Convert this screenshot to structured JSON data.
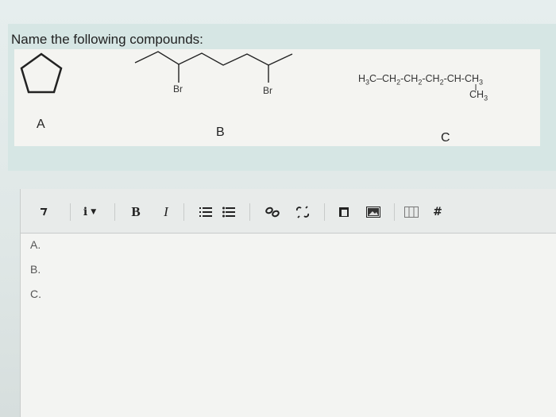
{
  "question": {
    "text": "Name the following compounds:"
  },
  "structures": {
    "labels": [
      "A",
      "B",
      "C"
    ],
    "b_substituents": [
      "Br",
      "Br"
    ],
    "c_formula": {
      "main_prefix": "H",
      "main_sub1": "3",
      "main_mid1": "C–CH",
      "main_sub2": "2",
      "main_mid2": "-CH",
      "main_sub3": "2",
      "main_mid3": "-CH",
      "main_sub4": "2",
      "main_mid4": "-CH-CH",
      "main_sub5": "3",
      "branch_text": "CH",
      "branch_sub": "3"
    }
  },
  "toolbar": {
    "paragraph_icon": "paragraph-format-icon",
    "info_label": "i",
    "bold_label": "B",
    "italic_label": "I",
    "icons": [
      "ordered-list-icon",
      "unordered-list-icon",
      "link-icon",
      "unlink-icon",
      "paste-icon",
      "image-icon",
      "table-icon",
      "hash-icon"
    ]
  },
  "answers": {
    "lines": [
      "A.",
      "B.",
      "C."
    ]
  }
}
